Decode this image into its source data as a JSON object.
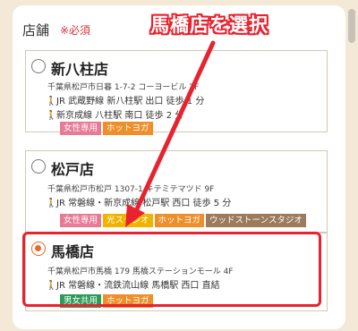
{
  "form": {
    "label": "店舗",
    "required": "※必須"
  },
  "annotation": {
    "title": "馬橋店を選択",
    "color": "#e8222e"
  },
  "stores": [
    {
      "name": "新八柱店",
      "address": "千葉県松戸市日暮 1-7-2 コーヨービル 2F",
      "access": [
        "JR 武蔵野線 新八柱駅 出口 徒歩 1 分",
        "新京成線 八柱駅 南口 徒歩 2 分"
      ],
      "tags": [
        {
          "label": "女性専用",
          "color": "#e87a96"
        },
        {
          "label": "ホットヨガ",
          "color": "#ef8f2b"
        }
      ],
      "selected": false
    },
    {
      "name": "松戸店",
      "address": "千葉県松戸市松戸 1307-1 キテミテマツド 9F",
      "access": [
        "JR 常磐線・新京成線 松戸駅 西口 徒歩 5 分"
      ],
      "tags": [
        {
          "label": "女性専用",
          "color": "#e87a96"
        },
        {
          "label": "光スタジオ",
          "color": "#f0b400"
        },
        {
          "label": "ホットヨガ",
          "color": "#ef8f2b"
        },
        {
          "label": "ウッドストーンスタジオ",
          "color": "#9c7a5b"
        }
      ],
      "selected": false
    },
    {
      "name": "馬橋店",
      "address": "千葉県松戸市馬橋 179 馬橋ステーションモール 4F",
      "access": [
        "JR 常磐線・流鉄流山線 馬橋駅 西口 直結"
      ],
      "tags": [
        {
          "label": "男女共用",
          "color": "#2e9a58"
        },
        {
          "label": "ホットヨガ",
          "color": "#ef8f2b"
        }
      ],
      "selected": true
    }
  ]
}
